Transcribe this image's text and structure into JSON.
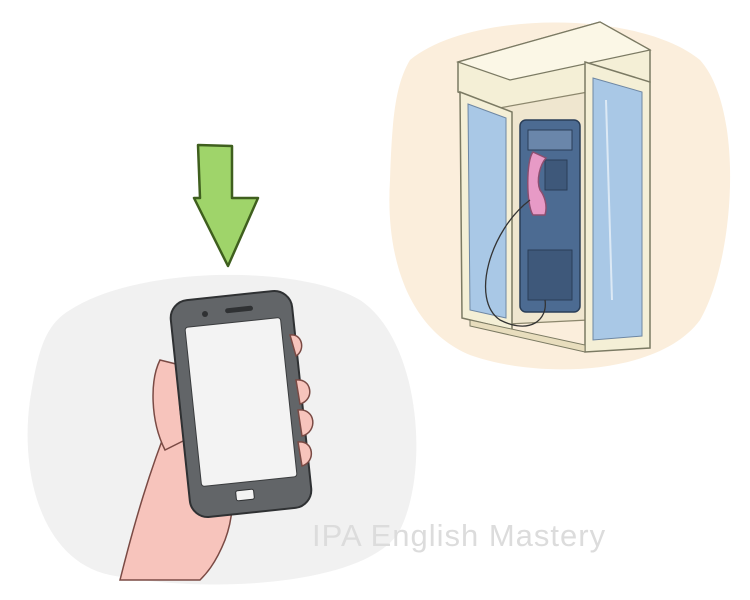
{
  "watermark": {
    "text": "IPA English Mastery"
  },
  "icons": {
    "arrow": "down-arrow-icon",
    "phone": "smartphone-icon",
    "booth": "phone-booth-icon"
  },
  "colors": {
    "arrow_fill": "#9fd46a",
    "arrow_stroke": "#3f5f1e",
    "background_blob_left": "#f1f1f1",
    "background_blob_right": "#fbeedc",
    "handset": "#e79ac6",
    "glass": "#a9c8e6",
    "booth_frame": "#f4efd6",
    "phone_body": "#626568",
    "phone_screen": "#f3f3f3",
    "skin": "#f7c4bc"
  }
}
